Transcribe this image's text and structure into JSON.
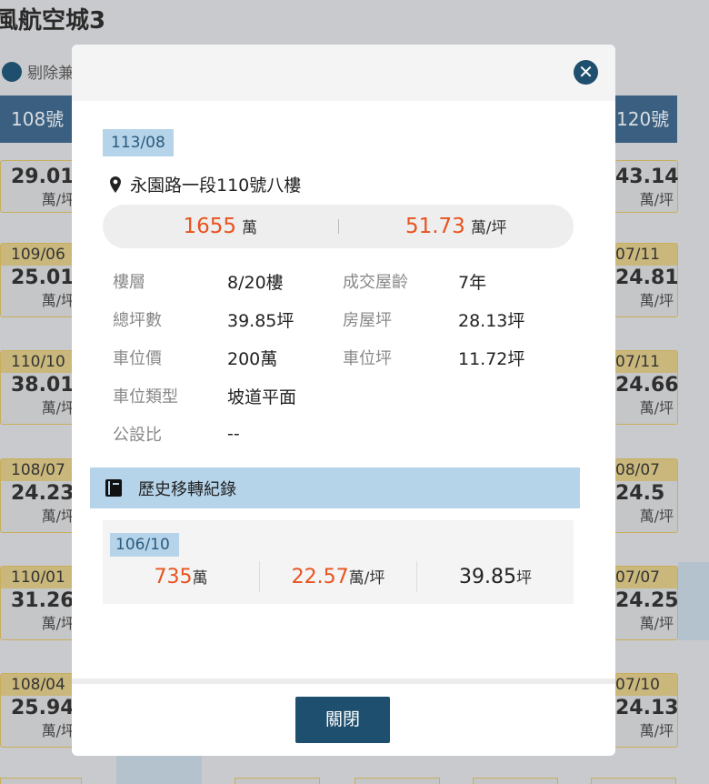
{
  "background": {
    "title": "風航空城3",
    "toggle_label": "剔除兼",
    "header_left": "108號",
    "header_right": "120號",
    "unit": "萬/坪",
    "left_cards": [
      {
        "date": "",
        "price": "29.01"
      },
      {
        "date": "109/06",
        "price": "25.01"
      },
      {
        "date": "110/10",
        "price": "38.01"
      },
      {
        "date": "108/07",
        "price": "24.23"
      },
      {
        "date": "110/01",
        "price": "31.26"
      },
      {
        "date": "108/04",
        "price": "25.94"
      }
    ],
    "right_cards": [
      {
        "date": "",
        "price": "43.14"
      },
      {
        "date": "07/11",
        "price": "24.81"
      },
      {
        "date": "07/11",
        "price": "24.66"
      },
      {
        "date": "08/07",
        "price": "24.5"
      },
      {
        "date": "07/07",
        "price": "24.25"
      },
      {
        "date": "07/10",
        "price": "24.13"
      }
    ]
  },
  "modal": {
    "close_icon": "close-icon",
    "date": "113/08",
    "address": "永園路一段110號八樓",
    "total_price": "1655",
    "total_unit": "萬",
    "unit_price": "51.73",
    "unit_price_unit": "萬/坪",
    "details": {
      "floor_label": "樓層",
      "floor_value": "8/20樓",
      "age_label": "成交屋齡",
      "age_value": "7年",
      "total_area_label": "總坪數",
      "total_area_value": "39.85坪",
      "house_area_label": "房屋坪",
      "house_area_value": "28.13坪",
      "parking_price_label": "車位價",
      "parking_price_value": "200萬",
      "parking_area_label": "車位坪",
      "parking_area_value": "11.72坪",
      "parking_type_label": "車位類型",
      "parking_type_value": "坡道平面",
      "public_ratio_label": "公設比",
      "public_ratio_value": "--"
    },
    "history_title": "歷史移轉紀錄",
    "history": [
      {
        "date": "106/10",
        "total": "735",
        "total_unit": "萬",
        "unit_price": "22.57",
        "unit_price_unit": "萬/坪",
        "area": "39.85",
        "area_unit": "坪"
      }
    ],
    "close_button": "關閉"
  },
  "colors": {
    "accent": "#1f4f6e",
    "price": "#e8531f",
    "badge_bg": "#b5d4ea",
    "gold": "#c9b77c"
  }
}
